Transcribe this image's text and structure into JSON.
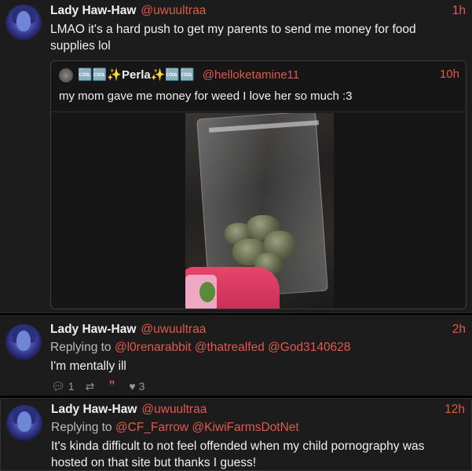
{
  "tweets": [
    {
      "name": "Lady Haw-Haw",
      "handle": "@uwuultraa",
      "time": "1h",
      "text": "LMAO it's a hard push to get my parents to send me money for food supplies lol",
      "quote": {
        "name": "🆒🆒✨Perla✨🆒🆒",
        "handle": "@helloketamine11",
        "time": "10h",
        "text": "my mom gave me money for weed I love her so much :3"
      }
    },
    {
      "name": "Lady Haw-Haw",
      "handle": "@uwuultraa",
      "time": "2h",
      "replying_prefix": "Replying to",
      "replying_to": "@l0renarabbit @thatrealfed @God3140628",
      "text": "I'm mentally ill",
      "actions": {
        "replies": "1",
        "retweets": "",
        "quotes": "",
        "likes": "3"
      }
    },
    {
      "name": "Lady Haw-Haw",
      "handle": "@uwuultraa",
      "time": "12h",
      "replying_prefix": "Replying to",
      "replying_to": "@CF_Farrow @KiwiFarmsDotNet",
      "text": "It's kinda difficult to not feel offended when my child pornography was hosted on that site but thanks I guess!"
    }
  ],
  "colors": {
    "accent": "#e0594c",
    "background": "#1c1c1c",
    "text": "#f0f0f0"
  }
}
